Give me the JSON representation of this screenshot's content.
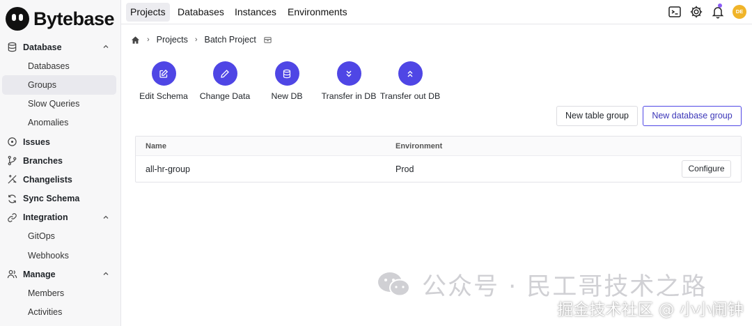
{
  "app": {
    "name": "Bytebase"
  },
  "sidebar": {
    "items": [
      {
        "label": "Database",
        "icon": "database-icon",
        "level": "top",
        "expanded": true
      },
      {
        "label": "Databases",
        "level": "sub"
      },
      {
        "label": "Groups",
        "level": "sub",
        "active": true
      },
      {
        "label": "Slow Queries",
        "level": "sub"
      },
      {
        "label": "Anomalies",
        "level": "sub"
      },
      {
        "label": "Issues",
        "icon": "issue-circle-icon",
        "level": "top"
      },
      {
        "label": "Branches",
        "icon": "branch-icon",
        "level": "top"
      },
      {
        "label": "Changelists",
        "icon": "changelist-icon",
        "level": "top"
      },
      {
        "label": "Sync Schema",
        "icon": "sync-icon",
        "level": "top"
      },
      {
        "label": "Integration",
        "icon": "link-icon",
        "level": "top",
        "expanded": true
      },
      {
        "label": "GitOps",
        "level": "sub"
      },
      {
        "label": "Webhooks",
        "level": "sub"
      },
      {
        "label": "Manage",
        "icon": "users-icon",
        "level": "top",
        "expanded": true
      },
      {
        "label": "Members",
        "level": "sub"
      },
      {
        "label": "Activities",
        "level": "sub"
      }
    ]
  },
  "topnav": {
    "tabs": [
      "Projects",
      "Databases",
      "Instances",
      "Environments"
    ],
    "active_tab": "Projects",
    "avatar_initials": "DE"
  },
  "breadcrumb": {
    "items": [
      "Projects",
      "Batch Project"
    ]
  },
  "quick_actions": [
    {
      "label": "Edit Schema",
      "icon": "edit-schema-icon"
    },
    {
      "label": "Change Data",
      "icon": "pencil-icon"
    },
    {
      "label": "New DB",
      "icon": "database-icon"
    },
    {
      "label": "Transfer in DB",
      "icon": "chevrons-down-icon"
    },
    {
      "label": "Transfer out DB",
      "icon": "chevrons-up-icon"
    }
  ],
  "buttons": {
    "new_table_group": "New table group",
    "new_database_group": "New database group"
  },
  "table": {
    "columns": [
      "Name",
      "Environment"
    ],
    "rows": [
      {
        "name": "all-hr-group",
        "environment": "Prod",
        "action": "Configure"
      }
    ]
  },
  "watermark": {
    "line1": "公众号 · 民工哥技术之路",
    "line2": "掘金技术社区 @ 小小闹钟"
  },
  "colors": {
    "accent": "#4f46e5",
    "sidebar_bg": "#f7f7f8",
    "avatar": "#f0b429"
  }
}
